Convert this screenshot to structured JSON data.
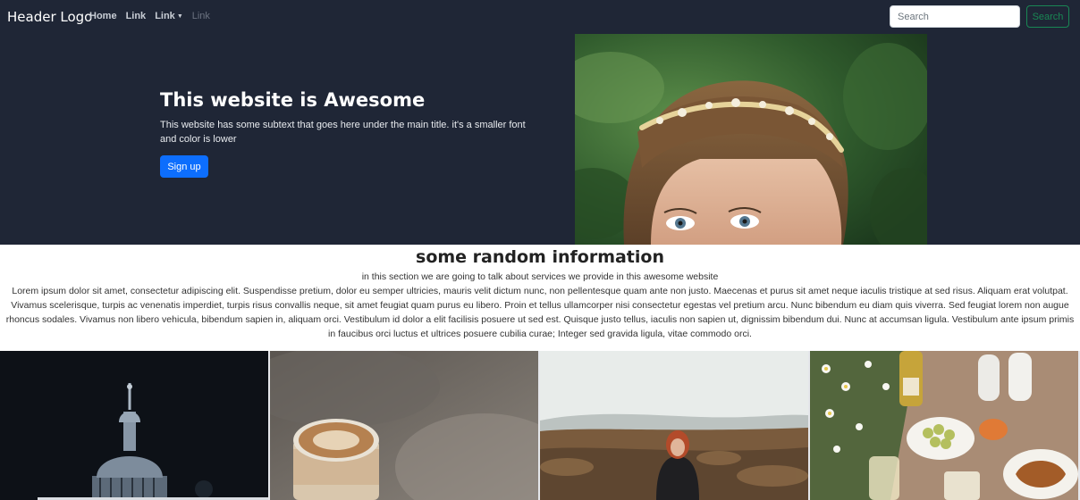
{
  "header": {
    "logo": "Header Logo",
    "nav": [
      {
        "label": "Home",
        "dropdown": false,
        "disabled": false
      },
      {
        "label": "Link",
        "dropdown": false,
        "disabled": false
      },
      {
        "label": "Link",
        "dropdown": true,
        "disabled": false
      },
      {
        "label": "Link",
        "dropdown": false,
        "disabled": true
      }
    ],
    "search": {
      "placeholder": "Search",
      "button_label": "Search"
    }
  },
  "hero": {
    "title": "This website is Awesome",
    "subtitle": "This website has some subtext that goes here under the main title. it's a smaller font and color is lower",
    "cta_label": "Sign up"
  },
  "info": {
    "title": "some random information",
    "subtitle": "in this section we are going to talk about services we provide in this awesome website",
    "body": "Lorem ipsum dolor sit amet, consectetur adipiscing elit. Suspendisse pretium, dolor eu semper ultricies, mauris velit dictum nunc, non pellentesque quam ante non justo. Maecenas et purus sit amet neque iaculis tristique at sed risus. Aliquam erat volutpat. Vivamus scelerisque, turpis ac venenatis imperdiet, turpis risus convallis neque, sit amet feugiat quam purus eu libero. Proin et tellus ullamcorper nisi consectetur egestas vel pretium arcu. Nunc bibendum eu diam quis viverra. Sed feugiat lorem non augue rhoncus sodales. Vivamus non libero vehicula, bibendum sapien in, aliquam orci. Vestibulum id dolor a elit facilisis posuere ut sed est. Quisque justo tellus, iaculis non sapien ut, dignissim bibendum dui. Nunc at accumsan ligula. Vestibulum ante ipsum primis in faucibus orci luctus et ultrices posuere cubilia curae; Integer sed gravida ligula, vitae commodo orci."
  },
  "theme": {
    "header_bg": "#1f2636",
    "primary": "#0d6efd",
    "success": "#198754"
  }
}
